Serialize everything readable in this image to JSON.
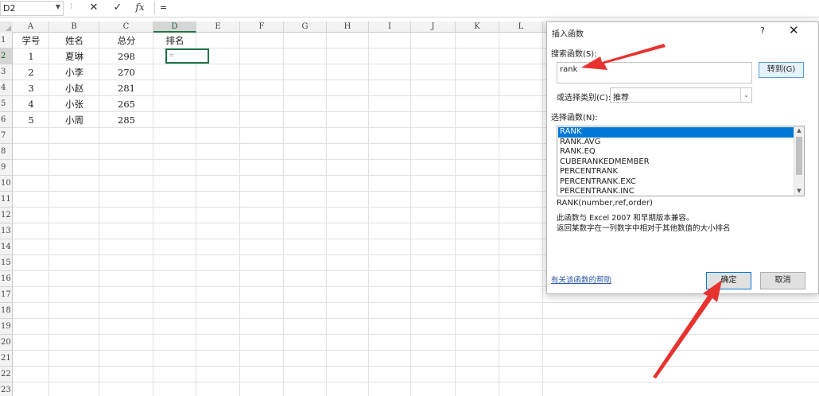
{
  "formula_bar": {
    "name_box": "D2",
    "separator": "⁝",
    "cancel_glyph": "✕",
    "enter_glyph": "✓",
    "fx_label": "fx",
    "formula": "="
  },
  "columns": [
    "A",
    "B",
    "C",
    "D",
    "E",
    "F",
    "G",
    "H",
    "I",
    "J",
    "K",
    "L"
  ],
  "rows": [
    "1",
    "2",
    "3",
    "4",
    "5",
    "6",
    "7",
    "8",
    "9",
    "10",
    "11",
    "12",
    "13",
    "14",
    "15",
    "16",
    "17",
    "18",
    "19",
    "20",
    "21",
    "22",
    "23"
  ],
  "selected_column": "D",
  "selected_row": "2",
  "active_cell": {
    "ref": "D2",
    "value": "="
  },
  "table": {
    "headers": [
      "学号",
      "姓名",
      "总分",
      "排名"
    ],
    "data": [
      [
        "1",
        "夏琳",
        "298"
      ],
      [
        "2",
        "小李",
        "270"
      ],
      [
        "3",
        "小赵",
        "281"
      ],
      [
        "4",
        "小张",
        "265"
      ],
      [
        "5",
        "小周",
        "285"
      ]
    ]
  },
  "dialog": {
    "title": "插入函数",
    "help": "?",
    "close": "✕",
    "search_label": "搜索函数(S):",
    "search_value": "rank",
    "go_button": "转到(G)",
    "category_label": "或选择类别(C):",
    "category_value": "推荐",
    "category_arrow": "⌄",
    "function_label": "选择函数(N):",
    "functions": [
      "RANK",
      "RANK.AVG",
      "RANK.EQ",
      "CUBERANKEDMEMBER",
      "PERCENTRANK",
      "PERCENTRANK.EXC",
      "PERCENTRANK.INC"
    ],
    "selected_function": "RANK",
    "scroll_up": "▲",
    "scroll_down": "▼",
    "syntax": "RANK(number,ref,order)",
    "description_line1": "此函数与 Excel 2007 和早期版本兼容。",
    "description_line2": "返回某数字在一列数字中相对于其他数值的大小排名",
    "help_link": "有关该函数的帮助",
    "ok_button": "确定",
    "cancel_button": "取消"
  },
  "annotation_color": "#e8322f"
}
